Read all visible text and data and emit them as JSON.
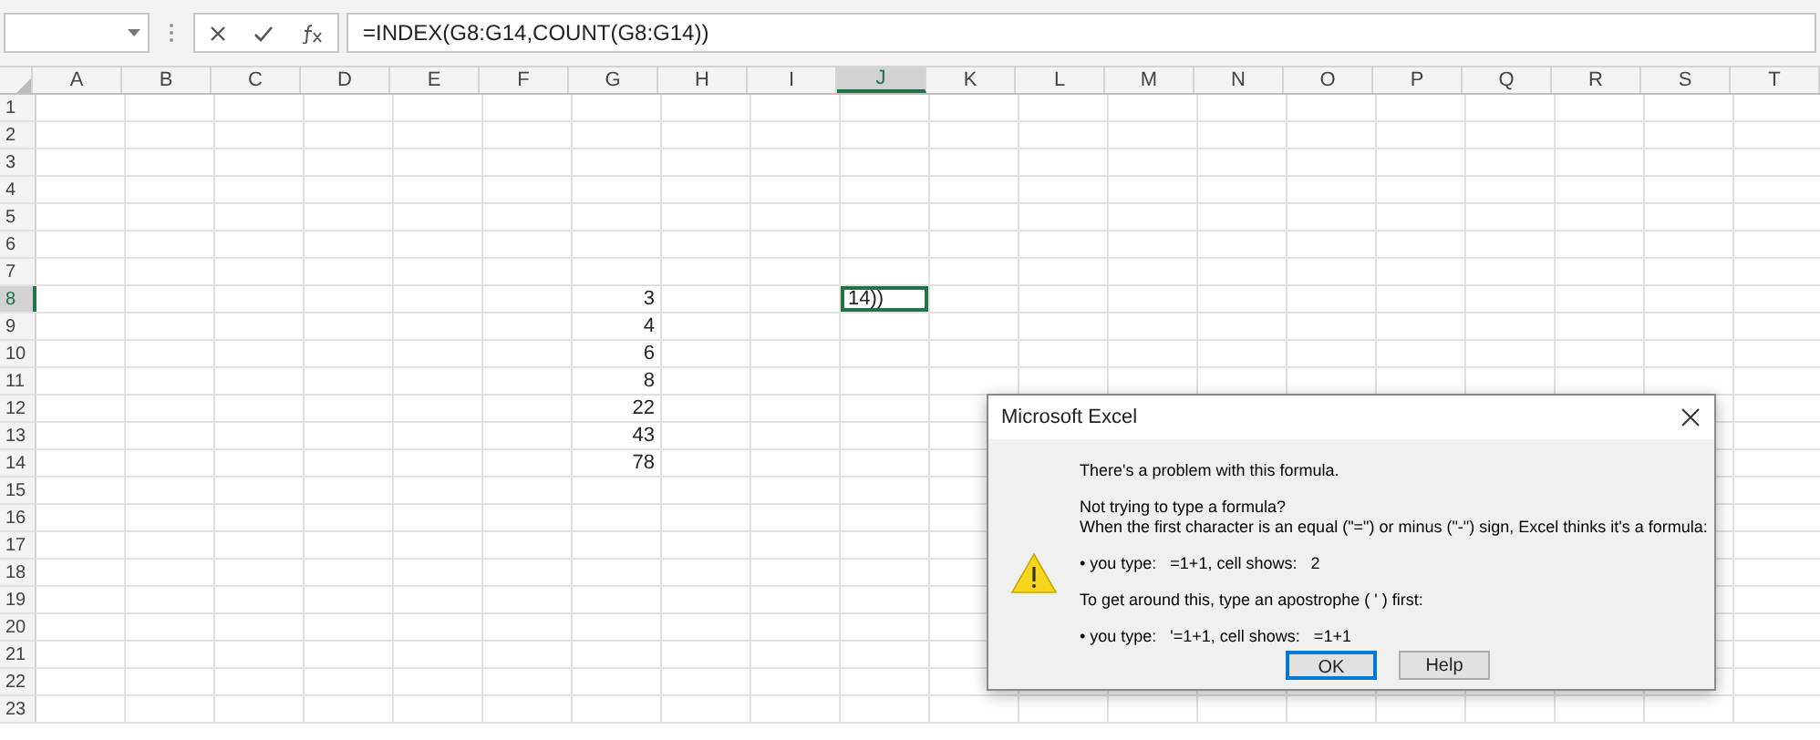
{
  "formula_bar": {
    "formula": "=INDEX(G8:G14,COUNT(G8:G14))"
  },
  "columns": [
    {
      "label": "A",
      "selected": false
    },
    {
      "label": "B",
      "selected": false
    },
    {
      "label": "C",
      "selected": false
    },
    {
      "label": "D",
      "selected": false
    },
    {
      "label": "E",
      "selected": false
    },
    {
      "label": "F",
      "selected": false
    },
    {
      "label": "G",
      "selected": false
    },
    {
      "label": "H",
      "selected": false
    },
    {
      "label": "I",
      "selected": false
    },
    {
      "label": "J",
      "selected": true
    },
    {
      "label": "K",
      "selected": false
    },
    {
      "label": "L",
      "selected": false
    },
    {
      "label": "M",
      "selected": false
    },
    {
      "label": "N",
      "selected": false
    },
    {
      "label": "O",
      "selected": false
    },
    {
      "label": "P",
      "selected": false
    },
    {
      "label": "Q",
      "selected": false
    },
    {
      "label": "R",
      "selected": false
    },
    {
      "label": "S",
      "selected": false
    },
    {
      "label": "T",
      "selected": false
    }
  ],
  "rows": [
    {
      "label": "1",
      "selected": false
    },
    {
      "label": "2",
      "selected": false
    },
    {
      "label": "3",
      "selected": false
    },
    {
      "label": "4",
      "selected": false
    },
    {
      "label": "5",
      "selected": false
    },
    {
      "label": "6",
      "selected": false
    },
    {
      "label": "7",
      "selected": false
    },
    {
      "label": "8",
      "selected": true,
      "cells": [
        null,
        null,
        null,
        null,
        null,
        null,
        {
          "value": "3",
          "active": false
        },
        null,
        null,
        {
          "value": "14))",
          "active": true
        }
      ]
    },
    {
      "label": "9",
      "selected": false,
      "cells": [
        null,
        null,
        null,
        null,
        null,
        null,
        {
          "value": "4",
          "active": false
        }
      ]
    },
    {
      "label": "10",
      "selected": false,
      "cells": [
        null,
        null,
        null,
        null,
        null,
        null,
        {
          "value": "6",
          "active": false
        }
      ]
    },
    {
      "label": "11",
      "selected": false,
      "cells": [
        null,
        null,
        null,
        null,
        null,
        null,
        {
          "value": "8",
          "active": false
        }
      ]
    },
    {
      "label": "12",
      "selected": false,
      "cells": [
        null,
        null,
        null,
        null,
        null,
        null,
        {
          "value": "22",
          "active": false
        }
      ]
    },
    {
      "label": "13",
      "selected": false,
      "cells": [
        null,
        null,
        null,
        null,
        null,
        null,
        {
          "value": "43",
          "active": false
        }
      ]
    },
    {
      "label": "14",
      "selected": false,
      "cells": [
        null,
        null,
        null,
        null,
        null,
        null,
        {
          "value": "78",
          "active": false
        }
      ]
    },
    {
      "label": "15",
      "selected": false
    },
    {
      "label": "16",
      "selected": false
    },
    {
      "label": "17",
      "selected": false
    },
    {
      "label": "18",
      "selected": false
    },
    {
      "label": "19",
      "selected": false
    },
    {
      "label": "20",
      "selected": false
    },
    {
      "label": "21",
      "selected": false
    },
    {
      "label": "22",
      "selected": false
    },
    {
      "label": "23",
      "selected": false
    }
  ],
  "dialog": {
    "title": "Microsoft Excel",
    "heading": "There's a problem with this formula.",
    "paragraphs": [
      [
        "Not trying to type a formula?",
        "When the first character is an equal (\"=\") or minus (\"-\") sign, Excel thinks it's a formula:"
      ],
      [
        "• you type:   =1+1, cell shows:   2"
      ],
      [
        "To get around this, type an apostrophe ( ' ) first:"
      ],
      [
        "• you type:   '=1+1, cell shows:   =1+1"
      ]
    ],
    "buttons": [
      {
        "label": "OK",
        "default": true
      },
      {
        "label": "Help",
        "default": false
      }
    ]
  }
}
